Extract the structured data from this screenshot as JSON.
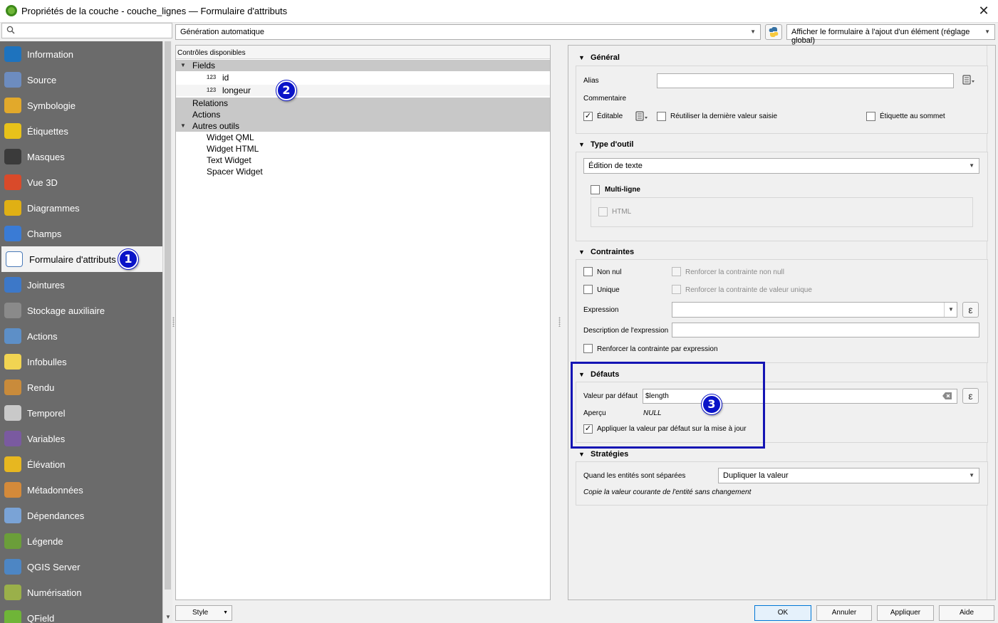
{
  "window": {
    "title": "Propriétés de la couche - couche_lignes — Formulaire d'attributs",
    "close_glyph": "✕"
  },
  "search": {
    "placeholder": ""
  },
  "sidebar": {
    "items": [
      {
        "label": "Information",
        "icon": "info-icon"
      },
      {
        "label": "Source",
        "icon": "source-icon"
      },
      {
        "label": "Symbologie",
        "icon": "symbology-icon"
      },
      {
        "label": "Étiquettes",
        "icon": "labels-icon"
      },
      {
        "label": "Masques",
        "icon": "masks-icon"
      },
      {
        "label": "Vue 3D",
        "icon": "3d-view-icon"
      },
      {
        "label": "Diagrammes",
        "icon": "diagrams-icon"
      },
      {
        "label": "Champs",
        "icon": "fields-icon"
      },
      {
        "label": "Formulaire d'attributs",
        "icon": "attributes-form-icon",
        "active": true
      },
      {
        "label": "Jointures",
        "icon": "joins-icon"
      },
      {
        "label": "Stockage auxiliaire",
        "icon": "auxiliary-storage-icon"
      },
      {
        "label": "Actions",
        "icon": "actions-icon"
      },
      {
        "label": "Infobulles",
        "icon": "tooltips-icon"
      },
      {
        "label": "Rendu",
        "icon": "rendering-icon"
      },
      {
        "label": "Temporel",
        "icon": "temporal-icon"
      },
      {
        "label": "Variables",
        "icon": "variables-icon"
      },
      {
        "label": "Élévation",
        "icon": "elevation-icon"
      },
      {
        "label": "Métadonnées",
        "icon": "metadata-icon"
      },
      {
        "label": "Dépendances",
        "icon": "dependencies-icon"
      },
      {
        "label": "Légende",
        "icon": "legend-icon"
      },
      {
        "label": "QGIS Server",
        "icon": "qgis-server-icon"
      },
      {
        "label": "Numérisation",
        "icon": "digitizing-icon"
      },
      {
        "label": "QField",
        "icon": "qfield-icon"
      }
    ]
  },
  "toolbar": {
    "layout_mode": "Génération automatique",
    "display_mode": "Afficher le formulaire à l'ajout d'un élément (réglage global)"
  },
  "tree": {
    "header": "Contrôles disponibles",
    "fields_group": "Fields",
    "field_type_badge": "123",
    "fields": [
      "id",
      "longeur"
    ],
    "relations": "Relations",
    "actions": "Actions",
    "other_tools": "Autres outils",
    "widgets": [
      "Widget QML",
      "Widget HTML",
      "Text Widget",
      "Spacer Widget"
    ]
  },
  "general": {
    "title": "Général",
    "alias_label": "Alias",
    "alias_value": "",
    "comment_label": "Commentaire",
    "editable_label": "Éditable",
    "editable_checked": true,
    "reuse_label": "Réutiliser la dernière valeur saisie",
    "label_on_top": "Étiquette au sommet"
  },
  "widget_type": {
    "title": "Type d'outil",
    "value": "Édition de texte",
    "multiline_label": "Multi-ligne",
    "html_label": "HTML"
  },
  "constraints": {
    "title": "Contraintes",
    "not_null": "Non nul",
    "enforce_not_null": "Renforcer la contrainte non null",
    "unique": "Unique",
    "enforce_unique": "Renforcer la contrainte de valeur unique",
    "expression_label": "Expression",
    "expression_value": "",
    "expr_desc_label": "Description de l'expression",
    "expr_desc_value": "",
    "enforce_expression": "Renforcer la contrainte par expression",
    "epsilon_glyph": "ε"
  },
  "defaults": {
    "title": "Défauts",
    "default_label": "Valeur par défaut",
    "default_value": "$length",
    "preview_label": "Aperçu",
    "preview_value": "NULL",
    "apply_on_update": "Appliquer la valeur par défaut sur la mise à jour",
    "apply_checked": true
  },
  "policies": {
    "title": "Stratégies",
    "split_label": "Quand les entités sont séparées",
    "split_value": "Dupliquer la valeur",
    "split_hint": "Copie la valeur courante de l'entité sans changement"
  },
  "badges": {
    "one": "1",
    "two": "2",
    "three": "3"
  },
  "footer": {
    "style": "Style",
    "ok": "OK",
    "cancel": "Annuler",
    "apply": "Appliquer",
    "help": "Aide"
  },
  "colors": {
    "highlight": "#1414b4",
    "badge": "#0a14c8",
    "sidebar_bg": "#6b6b6b"
  }
}
